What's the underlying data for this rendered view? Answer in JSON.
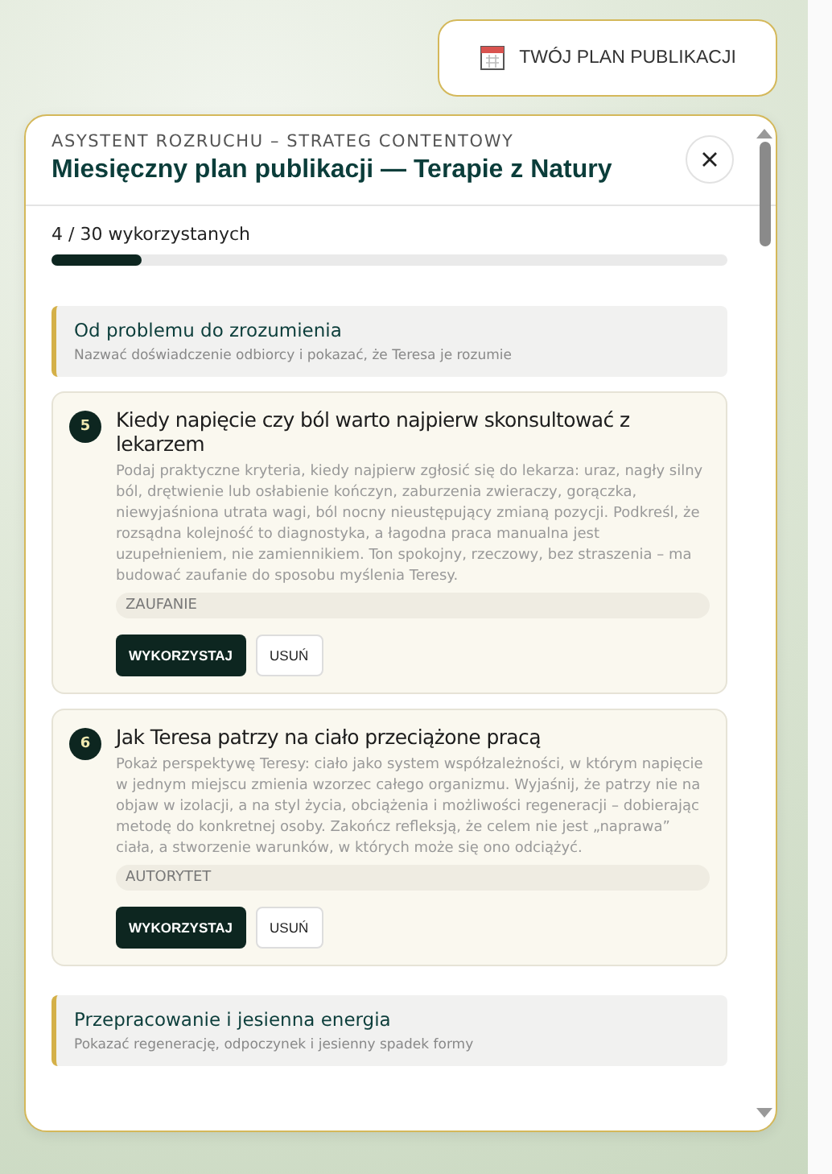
{
  "plan_button": {
    "label": "TWÓJ PLAN PUBLIKACJI"
  },
  "panel": {
    "eyebrow": "ASYSTENT ROZRUCHU – STRATEG CONTENTOWY",
    "title": "Miesięczny plan publikacji — Terapie z Natury"
  },
  "progress": {
    "label": "4 / 30 wykorzystanych",
    "level": 0.133
  },
  "sections": [
    {
      "kind": "section",
      "title": "Od problemu do zrozumienia",
      "subtitle": "Nazwać doświadczenie odbiorcy i pokazać, że Teresa je rozumie"
    },
    {
      "kind": "idea",
      "number": "5",
      "title": "Kiedy napięcie czy ból warto najpierw skonsultować z lekarzem",
      "text": "Podaj praktyczne kryteria, kiedy najpierw zgłosić się do lekarza: uraz, nagły silny ból, drętwienie lub osłabienie kończyn, zaburzenia zwieraczy, gorączka, niewyjaśniona utrata wagi, ból nocny nieustępujący zmianą pozycji. Podkreśl, że rozsądna kolejność to diagnostyka, a łagodna praca manualna jest uzupełnieniem, nie zamiennikiem. Ton spokojny, rzeczowy, bez straszenia – ma budować zaufanie do sposobu myślenia Teresy.",
      "tag": "ZAUFANIE",
      "use_label": "WYKORZYSTAJ",
      "remove_label": "USUŃ"
    },
    {
      "kind": "idea",
      "number": "6",
      "title": "Jak Teresa patrzy na ciało przeciążone pracą",
      "text": "Pokaż perspektywę Teresy: ciało jako system współzależności, w którym napięcie w jednym miejscu zmienia wzorzec całego organizmu. Wyjaśnij, że patrzy nie na objaw w izolacji, a na styl życia, obciążenia i możliwości regeneracji – dobierając metodę do konkretnej osoby. Zakończ refleksją, że celem nie jest „naprawa” ciała, a stworzenie warunków, w których może się ono odciążyć.",
      "tag": "AUTORYTET",
      "use_label": "WYKORZYSTAJ",
      "remove_label": "USUŃ"
    },
    {
      "kind": "section",
      "title": "Przepracowanie i jesienna energia",
      "subtitle": "Pokazać regenerację, odpoczynek i jesienny spadek formy"
    }
  ]
}
